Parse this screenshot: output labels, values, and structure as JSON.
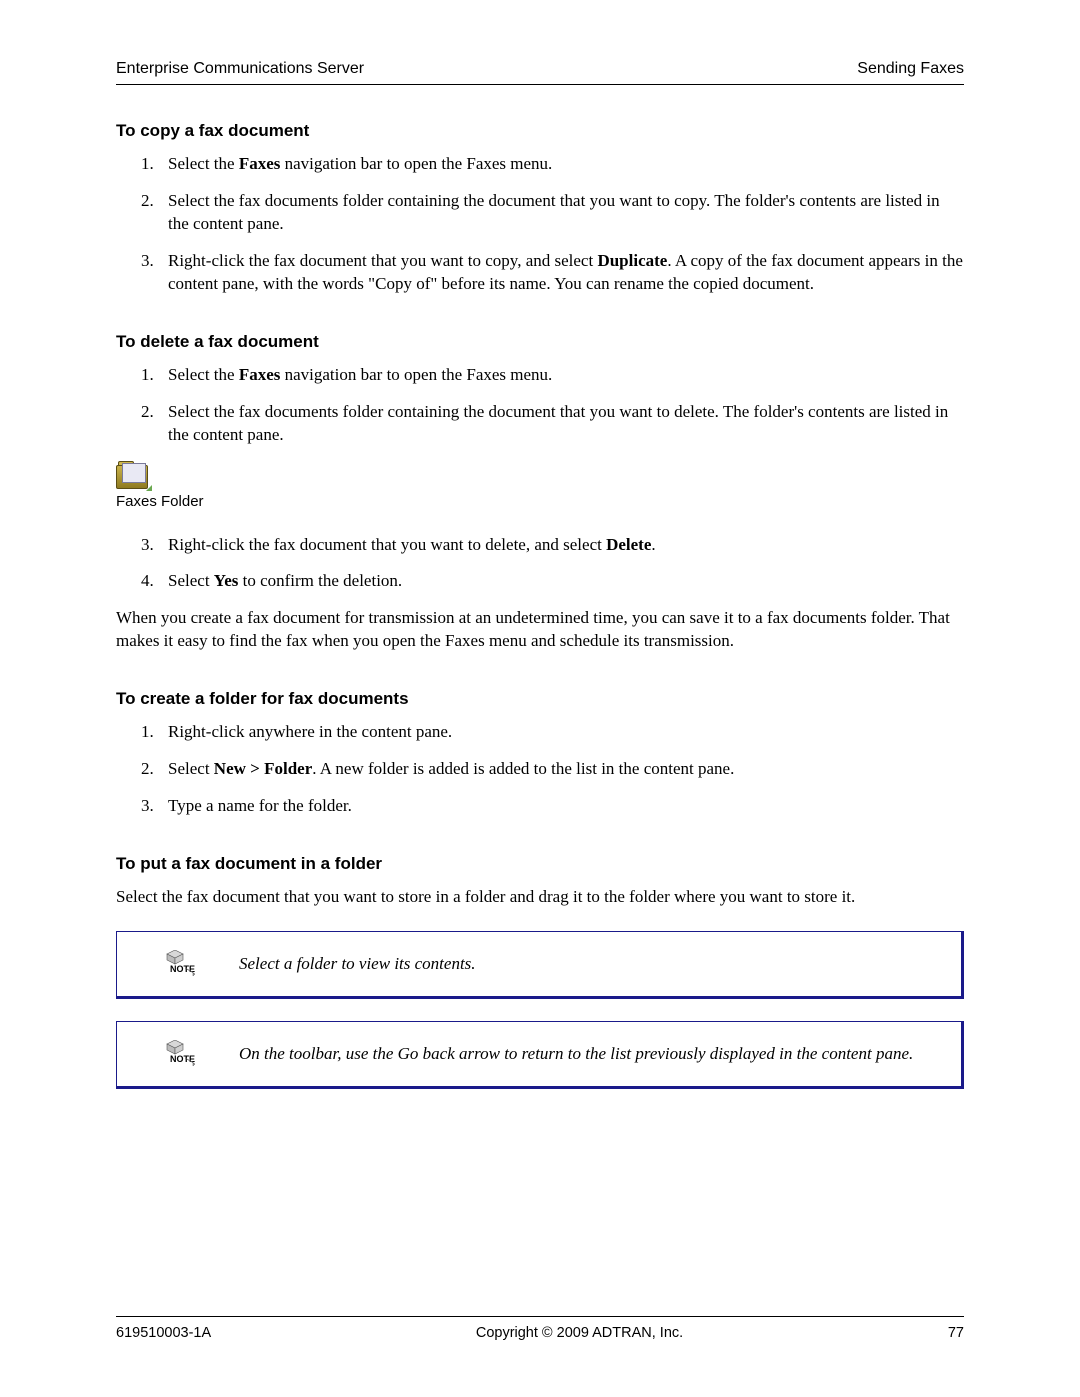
{
  "header": {
    "left": "Enterprise Communications Server",
    "right": "Sending Faxes"
  },
  "section1": {
    "title": "To copy a fax document",
    "step1_pre": "Select the ",
    "step1_bold": "Faxes",
    "step1_post": " navigation bar to open the Faxes menu.",
    "step2": "Select the fax documents folder containing the document that you want to copy. The folder's contents are listed in the content pane.",
    "step3_pre": "Right-click the fax document that you want to copy, and select ",
    "step3_bold": "Duplicate",
    "step3_post": ". A copy of the fax document appears in the content pane, with the words \"Copy of\" before its name. You can rename the copied document."
  },
  "section2": {
    "title": "To delete a fax document",
    "step1_pre": "Select the ",
    "step1_bold": "Faxes",
    "step1_post": " navigation bar to open the Faxes menu.",
    "step2": "Select the fax documents folder containing the document that you want to delete. The folder's contents are listed in the content pane.",
    "folder_label": "Faxes Folder",
    "step3_pre": "Right-click the fax document that you want to delete, and select ",
    "step3_bold": "Delete",
    "step3_post": ".",
    "step4_pre": "Select ",
    "step4_bold": "Yes",
    "step4_post": " to confirm the deletion.",
    "paragraph": "When you create a fax document for transmission at an undetermined time, you can save it to a fax documents folder. That makes it easy to find the fax when you open the Faxes menu and schedule its transmission."
  },
  "section3": {
    "title": "To create a folder for fax documents",
    "step1": "Right-click anywhere in the content pane.",
    "step2_pre": "Select ",
    "step2_bold": "New > Folder",
    "step2_post": ". A new folder is added is added to the list in the content pane.",
    "step3": "Type a name for the folder."
  },
  "section4": {
    "title": "To put a fax document in a folder",
    "paragraph": "Select the fax document that you want to store in a folder and drag it to the folder where you want to store it."
  },
  "notes": {
    "note1": "Select a folder to view its contents.",
    "note2": "On the toolbar, use the Go back arrow to return to the list previously displayed in the content pane."
  },
  "footer": {
    "left": "619510003-1A",
    "center": "Copyright © 2009 ADTRAN, Inc.",
    "right": "77"
  }
}
